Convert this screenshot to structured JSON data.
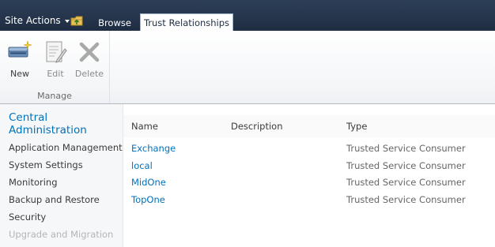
{
  "topbar": {
    "site_actions_label": "Site Actions",
    "tabs": [
      {
        "label": "Browse",
        "selected": false
      },
      {
        "label": "Trust Relationships",
        "selected": true
      }
    ]
  },
  "ribbon": {
    "buttons": [
      {
        "label": "New",
        "icon": "new-trust-icon",
        "enabled": true
      },
      {
        "label": "Edit",
        "icon": "edit-page-icon",
        "enabled": false
      },
      {
        "label": "Delete",
        "icon": "delete-x-icon",
        "enabled": false
      }
    ],
    "group_label": "Manage"
  },
  "leftnav": {
    "heading": "Central Administration",
    "items": [
      "Application Management",
      "System Settings",
      "Monitoring",
      "Backup and Restore",
      "Security",
      "Upgrade and Migration"
    ]
  },
  "list": {
    "columns": [
      "Name",
      "Description",
      "Type"
    ],
    "rows": [
      {
        "name": "Exchange",
        "description": "",
        "type": "Trusted Service Consumer"
      },
      {
        "name": "local",
        "description": "",
        "type": "Trusted Service Consumer"
      },
      {
        "name": "MidOne",
        "description": "",
        "type": "Trusted Service Consumer"
      },
      {
        "name": "TopOne",
        "description": "",
        "type": "Trusted Service Consumer"
      }
    ]
  },
  "colors": {
    "topbar": "#1f2d42",
    "link": "#0072bc",
    "nav_background": "#f6f7f9"
  }
}
